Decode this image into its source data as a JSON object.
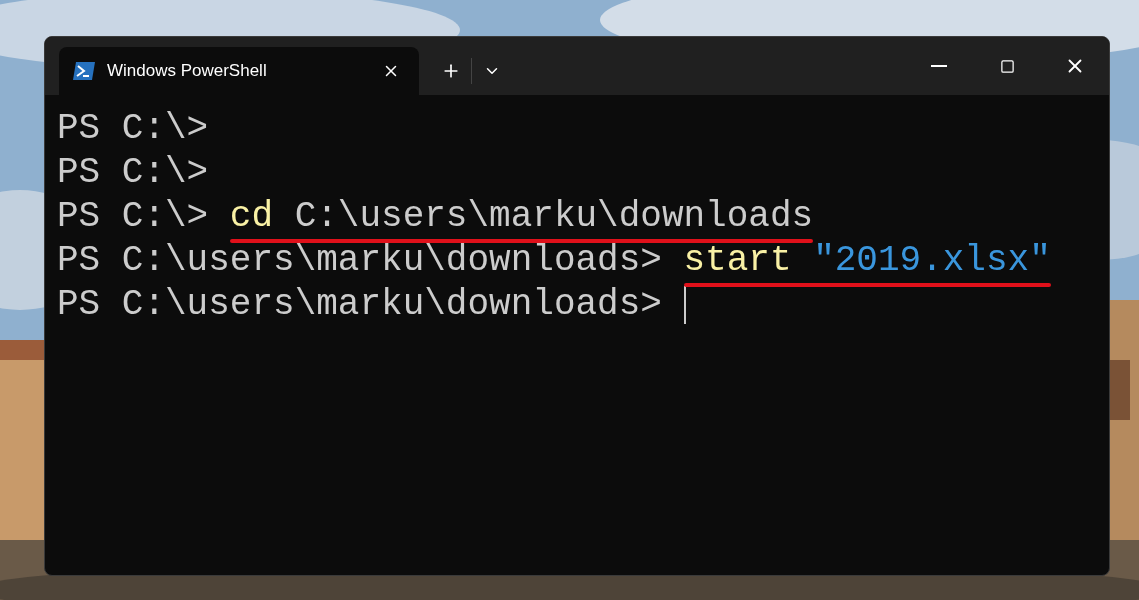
{
  "tabs": [
    {
      "title": "Windows PowerShell",
      "selected": true
    }
  ],
  "lines": [
    {
      "prompt": "PS C:\\>"
    },
    {
      "prompt": "PS C:\\>"
    },
    {
      "prompt": "PS C:\\>",
      "tokens": [
        {
          "kind": "command",
          "text": "cd"
        },
        {
          "kind": "argument",
          "text": "C:\\users\\marku\\downloads"
        }
      ],
      "underlined": true
    },
    {
      "prompt": "PS C:\\users\\marku\\downloads>",
      "tokens": [
        {
          "kind": "command",
          "text": "start"
        },
        {
          "kind": "string",
          "text": "\"2019.xlsx\""
        }
      ],
      "underlined": true
    },
    {
      "prompt": "PS C:\\users\\marku\\downloads>",
      "cursor": true
    }
  ]
}
